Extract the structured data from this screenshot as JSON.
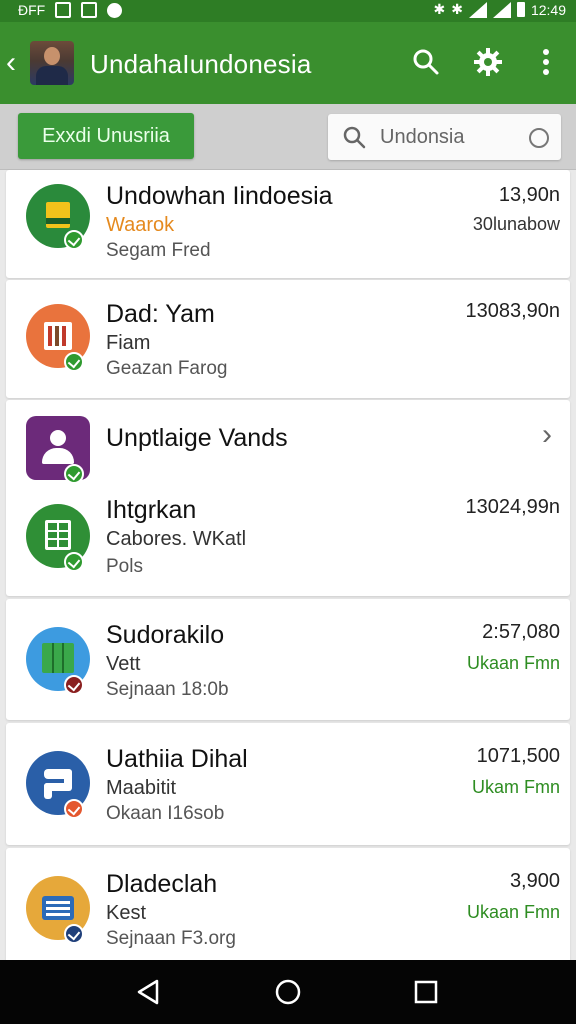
{
  "status_bar": {
    "left_text": "ĐFF",
    "time": "12:49"
  },
  "header": {
    "title": "UndahaIundonesia"
  },
  "toolbar": {
    "button_label": "Exxdi Unusriia",
    "search_value": "Undonsia"
  },
  "items": [
    {
      "name": "Undowhan Iindoesia",
      "sub1": "Waarok",
      "sub2": "Segam Fred",
      "amount": "13,90n",
      "amount2": "30lunabow"
    },
    {
      "name": "Dad: Yam",
      "sub1": "Fiam",
      "sub2": "Geazan Farog",
      "amount": "13083,90n",
      "amount2": ""
    },
    {
      "name": "Unptlaige Vands",
      "sub1": "",
      "sub2": "",
      "amount": "",
      "amount2": ""
    },
    {
      "name": "Ihtgrkan",
      "sub1": "Cabores. WKatl",
      "sub2": "Pols",
      "amount": "13024,99n",
      "amount2": ""
    },
    {
      "name": "Sudorakilo",
      "sub1": "Vett",
      "sub2": "Sejnaan 18:0b",
      "amount": "2:57,080",
      "amount2": "Ukaan Fmn"
    },
    {
      "name": "Uathiia Dihal",
      "sub1": "Maabitit",
      "sub2": "Okaan I16sob",
      "amount": "1071,500",
      "amount2": "Ukam Fmn"
    },
    {
      "name": "Dladeclah",
      "sub1": "Kest",
      "sub2": "Sejnaan F3.org",
      "amount": "3,900",
      "amount2": "Ukaan Fmn"
    }
  ],
  "colors": {
    "appbar": "#3a8f2e",
    "statusbar": "#2e7d25",
    "accent_green": "#2e8d22",
    "accent_orange": "#e58a1f"
  }
}
